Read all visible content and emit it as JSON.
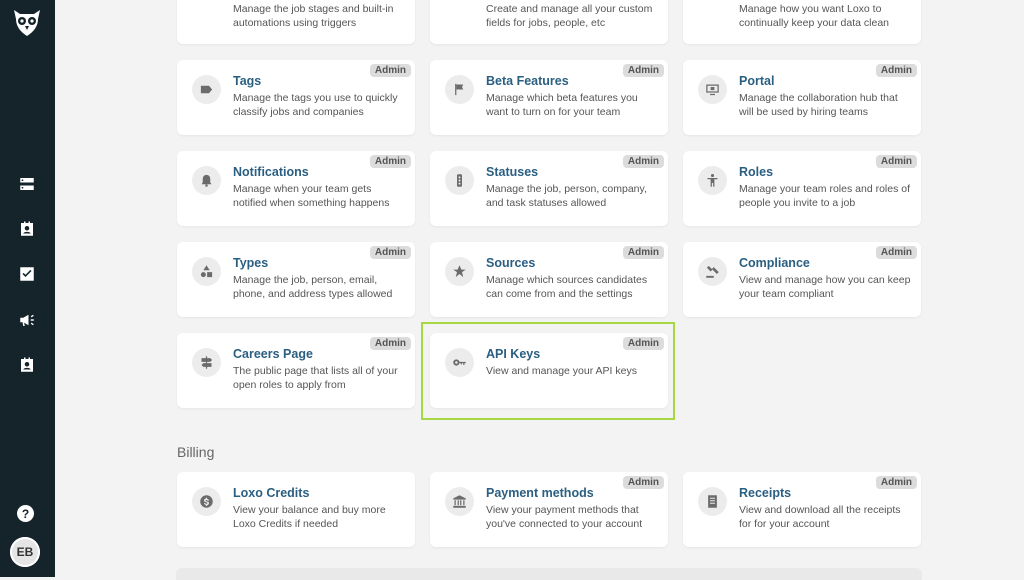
{
  "sidebar": {
    "logo": "owl-logo",
    "items": [
      {
        "icon": "storage-icon"
      },
      {
        "icon": "contact-card-icon"
      },
      {
        "icon": "checkbox-icon"
      },
      {
        "icon": "megaphone-icon"
      },
      {
        "icon": "assignment-icon"
      }
    ],
    "help": "?",
    "avatar": "EB"
  },
  "top_cards": [
    {
      "desc": "Manage the job stages and built-in automations using triggers"
    },
    {
      "desc": "Create and manage all your custom fields for jobs, people, etc"
    },
    {
      "desc": "Manage how you want Loxo to continually keep your data clean"
    }
  ],
  "cards": [
    {
      "title": "Tags",
      "desc": "Manage the tags you use to quickly classify jobs and companies",
      "badge": "Admin",
      "icon": "tag-icon"
    },
    {
      "title": "Beta Features",
      "desc": "Manage which beta features you want to turn on for your team",
      "badge": "Admin",
      "icon": "flag-icon"
    },
    {
      "title": "Portal",
      "desc": "Manage the collaboration hub that will be used by hiring teams",
      "badge": "Admin",
      "icon": "portal-icon"
    },
    {
      "title": "Notifications",
      "desc": "Manage when your team gets notified when something happens",
      "badge": "Admin",
      "icon": "bell-icon"
    },
    {
      "title": "Statuses",
      "desc": "Manage the job, person, company, and task statuses allowed",
      "badge": "Admin",
      "icon": "traffic-light-icon"
    },
    {
      "title": "Roles",
      "desc": "Manage your team roles and roles of people you invite to a job",
      "badge": "Admin",
      "icon": "person-icon"
    },
    {
      "title": "Types",
      "desc": "Manage the job, person, email, phone, and address types allowed",
      "badge": "Admin",
      "icon": "shapes-icon"
    },
    {
      "title": "Sources",
      "desc": "Manage which sources candidates can come from and the settings",
      "badge": "Admin",
      "icon": "star-icon"
    },
    {
      "title": "Compliance",
      "desc": "View and manage how you can keep your team compliant",
      "badge": "Admin",
      "icon": "gavel-icon"
    },
    {
      "title": "Careers Page",
      "desc": "The public page that lists all of your open roles to apply from",
      "badge": "Admin",
      "icon": "signpost-icon"
    },
    {
      "title": "API Keys",
      "desc": "View and manage your API keys",
      "badge": "Admin",
      "icon": "key-icon"
    }
  ],
  "billing": {
    "section_title": "Billing",
    "cards": [
      {
        "title": "Loxo Credits",
        "desc": "View your balance and buy more Loxo Credits if needed",
        "icon": "dollar-icon"
      },
      {
        "title": "Payment methods",
        "desc": "View your payment methods that you've connected to your account",
        "badge": "Admin",
        "icon": "bank-icon"
      },
      {
        "title": "Receipts",
        "desc": "View and download all the receipts for for your account",
        "badge": "Admin",
        "icon": "receipt-icon"
      }
    ]
  },
  "colors": {
    "sidebar_bg": "#15232b",
    "title_blue": "#2a5f82",
    "highlight": "#a5d841",
    "page_bg": "#f3f3f3"
  }
}
